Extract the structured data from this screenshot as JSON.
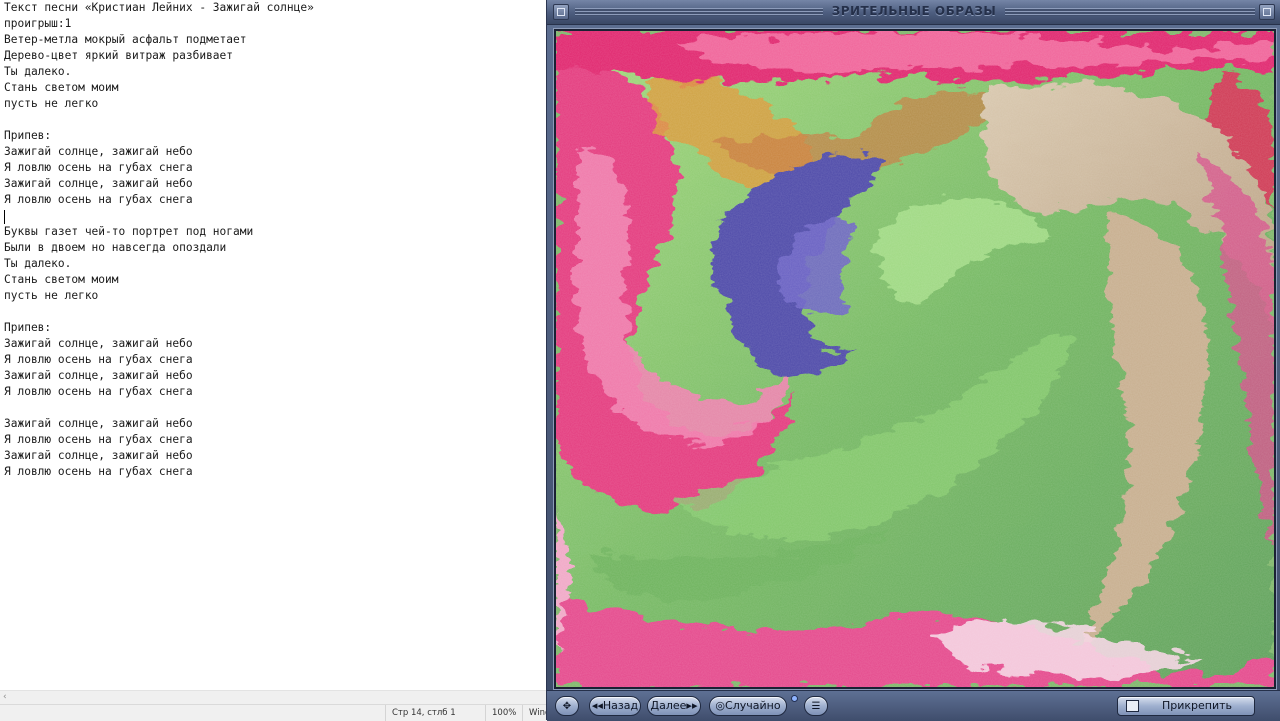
{
  "editor": {
    "lines": [
      "Текст песни «Кристиан Лейних - Зажигай солнце»",
      "проигрыш:1",
      "Ветер-метла мокрый асфальт подметает",
      "Дерево-цвет яркий витраж разбивает",
      "Ты далеко.",
      "Стань светом моим",
      "пусть не легко",
      "",
      "Припев:",
      "Зажигай солнце, зажигай небо",
      "Я ловлю осень на губах снега",
      "Зажигай солнце, зажигай небо",
      "Я ловлю осень на губах снега",
      "",
      "Буквы газет чей-то портрет под ногами",
      "Были в двоем но навсегда опоздали",
      "Ты далеко.",
      "Стань светом моим",
      "пусть не легко",
      "",
      "Припев:",
      "Зажигай солнце, зажигай небо",
      "Я ловлю осень на губах снега",
      "Зажигай солнце, зажигай небо",
      "Я ловлю осень на губах снега",
      "",
      "Зажигай солнце, зажигай небо",
      "Я ловлю осень на губах снега",
      "Зажигай солнце, зажигай небо",
      "Я ловлю осень на губах снега"
    ]
  },
  "statusbar": {
    "position": "Стр 14, стлб 1",
    "zoom": "100%",
    "encoding": "Wind"
  },
  "scrollbar": {
    "left_arrow": "‹"
  },
  "visualizer": {
    "title": "ЗРИТЕЛЬНЫЕ ОБРАЗЫ",
    "controls": {
      "move_icon": "✥",
      "back_label": "◂◂Назад",
      "next_label": "Далее▸▸",
      "random_label": "◎Случайно",
      "menu_icon": "☰",
      "pin_label": "Прикрепить"
    }
  },
  "colors": {
    "window_frame": "#4c5c7e",
    "title_text": "#25304a",
    "paint_green": "#7fbf6c",
    "paint_magenta": "#e0286e",
    "paint_beige": "#c9b598",
    "paint_blue": "#4d49a8"
  }
}
